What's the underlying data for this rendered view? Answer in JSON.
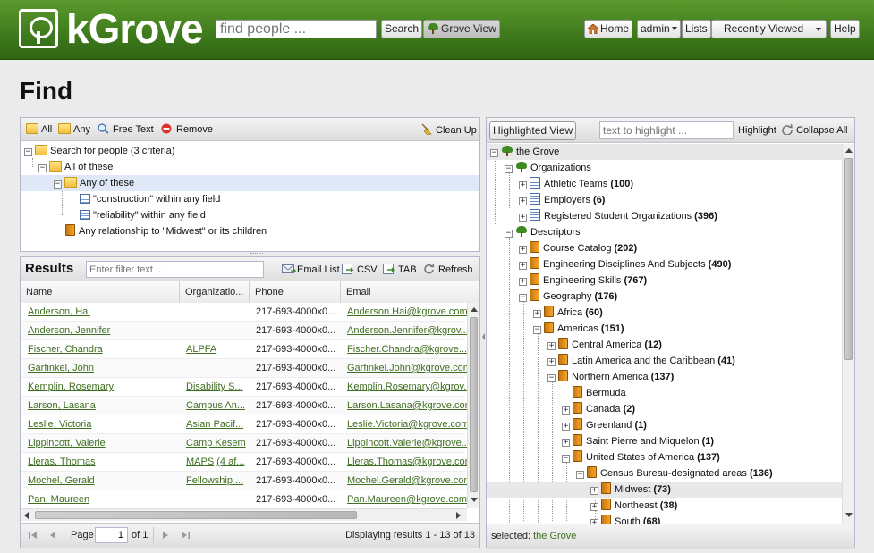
{
  "header": {
    "logo_text": "kGrove",
    "search_placeholder": "find people ...",
    "search_label": "Search",
    "grove_view_label": "Grove View",
    "home_label": "Home",
    "admin_label": "admin",
    "lists_label": "Lists",
    "recently_viewed_label": "Recently Viewed",
    "help_label": "Help"
  },
  "page_title": "Find",
  "criteria": {
    "toolbar": {
      "all": "All",
      "any": "Any",
      "free_text": "Free Text",
      "remove": "Remove",
      "clean_up": "Clean Up"
    },
    "tree": [
      {
        "label": "Search for people (3 criteria)"
      },
      {
        "label": "All of these"
      },
      {
        "label": "Any of these"
      },
      {
        "label": "\"construction\" within any field"
      },
      {
        "label": "\"reliability\" within any field"
      },
      {
        "label": "Any relationship to \"Midwest\" or its children"
      }
    ]
  },
  "results": {
    "title": "Results",
    "filter_placeholder": "Enter filter text ...",
    "email_list": "Email List",
    "csv": "CSV",
    "tab": "TAB",
    "refresh": "Refresh",
    "columns": [
      "Name",
      "Organizatio...",
      "Phone",
      "Email"
    ],
    "rows": [
      {
        "name": "Anderson, Hai",
        "org": "",
        "org2": "",
        "phone": "217-693-4000x0...",
        "email": "Anderson.Hai@kgrove.com"
      },
      {
        "name": "Anderson, Jennifer",
        "org": "",
        "org2": "",
        "phone": "217-693-4000x0...",
        "email": "Anderson.Jennifer@kgrov..."
      },
      {
        "name": "Fischer, Chandra",
        "org": "ALPFA",
        "org2": "",
        "phone": "217-693-4000x0...",
        "email": "Fischer.Chandra@kgrove..."
      },
      {
        "name": "Garfinkel, John",
        "org": "",
        "org2": "",
        "phone": "217-693-4000x0...",
        "email": "Garfinkel.John@kgrove.com"
      },
      {
        "name": "Kemplin, Rosemary",
        "org": "Disability S...",
        "org2": "",
        "phone": "217-693-4000x0...",
        "email": "Kemplin.Rosemary@kgrov..."
      },
      {
        "name": "Larson, Lasana",
        "org": "Campus An...",
        "org2": "",
        "phone": "217-693-4000x0...",
        "email": "Larson.Lasana@kgrove.com"
      },
      {
        "name": "Leslie, Victoria",
        "org": "Asian Pacif...",
        "org2": "",
        "phone": "217-693-4000x0...",
        "email": "Leslie.Victoria@kgrove.com"
      },
      {
        "name": "Lippincott, Valerie",
        "org": "Camp Kesem",
        "org2": "",
        "phone": "217-693-4000x0...",
        "email": "Lippincott.Valerie@kgrove..."
      },
      {
        "name": "Lleras, Thomas",
        "org": "MAPS",
        "org2": "(4 af...",
        "phone": "217-693-4000x0...",
        "email": "Lleras.Thomas@kgrove.com"
      },
      {
        "name": "Mochel, Gerald",
        "org": "Fellowship ...",
        "org2": "",
        "phone": "217-693-4000x0...",
        "email": "Mochel.Gerald@kgrove.com"
      },
      {
        "name": "Pan, Maureen",
        "org": "",
        "org2": "",
        "phone": "217-693-4000x0...",
        "email": "Pan.Maureen@kgrove.com"
      }
    ],
    "pager": {
      "page_label": "Page",
      "page_value": "1",
      "of_label": "of 1",
      "displaying": "Displaying results 1 - 13 of 13"
    }
  },
  "grove": {
    "highlighted_view": "Highlighted View",
    "highlight_placeholder": "text to highlight ...",
    "highlight_label": "Highlight",
    "collapse_all": "Collapse All",
    "tree": [
      {
        "label": "the Grove",
        "count": ""
      },
      {
        "label": "Organizations",
        "count": ""
      },
      {
        "label": "Athletic Teams",
        "count": "(100)"
      },
      {
        "label": "Employers",
        "count": "(6)"
      },
      {
        "label": "Registered Student Organizations",
        "count": "(396)"
      },
      {
        "label": "Descriptors",
        "count": ""
      },
      {
        "label": "Course Catalog",
        "count": "(202)"
      },
      {
        "label": "Engineering Disciplines And Subjects",
        "count": "(490)"
      },
      {
        "label": "Engineering Skills",
        "count": "(767)"
      },
      {
        "label": "Geography",
        "count": "(176)"
      },
      {
        "label": "Africa",
        "count": "(60)"
      },
      {
        "label": "Americas",
        "count": "(151)"
      },
      {
        "label": "Central America",
        "count": "(12)"
      },
      {
        "label": "Latin America and the Caribbean",
        "count": "(41)"
      },
      {
        "label": "Northern America",
        "count": "(137)"
      },
      {
        "label": "Bermuda",
        "count": ""
      },
      {
        "label": "Canada",
        "count": "(2)"
      },
      {
        "label": "Greenland",
        "count": "(1)"
      },
      {
        "label": "Saint Pierre and Miquelon",
        "count": "(1)"
      },
      {
        "label": "United States of America",
        "count": "(137)"
      },
      {
        "label": "Census Bureau-designated areas",
        "count": "(136)"
      },
      {
        "label": "Midwest",
        "count": "(73)"
      },
      {
        "label": "Northeast",
        "count": "(38)"
      },
      {
        "label": "South",
        "count": "(68)"
      }
    ],
    "selected_label": "selected:",
    "selected_value": "the Grove"
  }
}
